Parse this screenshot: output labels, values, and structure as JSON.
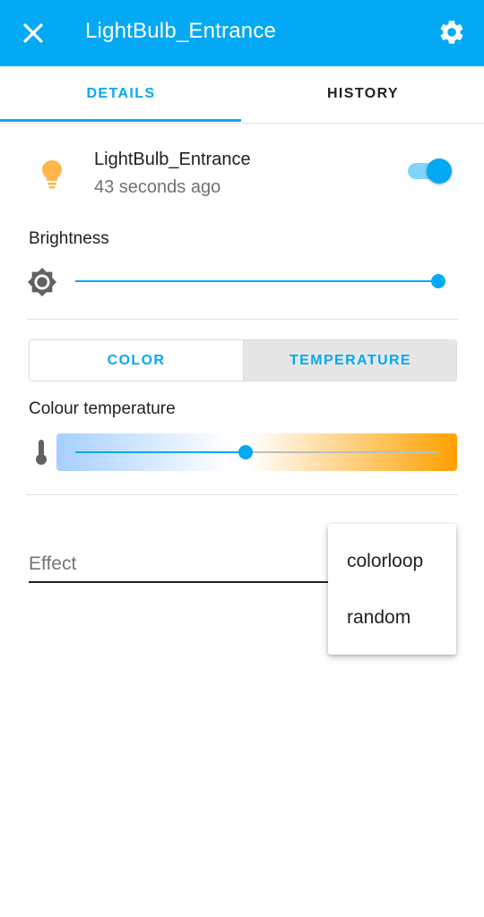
{
  "header": {
    "title": "LightBulb_Entrance",
    "close_icon": "close-icon",
    "settings_icon": "gear-icon",
    "background_color": "#03a9f4"
  },
  "tabs": [
    {
      "label": "DETAILS",
      "active": true
    },
    {
      "label": "HISTORY",
      "active": false
    }
  ],
  "entity": {
    "name": "LightBulb_Entrance",
    "last_changed": "43 seconds ago",
    "icon": "lightbulb-icon",
    "icon_color": "#ffb74d",
    "state_on": true
  },
  "brightness": {
    "label": "Brightness",
    "icon": "brightness-icon",
    "value_fraction": 1.0
  },
  "mode": {
    "options": [
      "COLOR",
      "TEMPERATURE"
    ],
    "selected": "TEMPERATURE"
  },
  "color_temperature": {
    "label": "Colour temperature",
    "icon": "thermometer-icon",
    "value_fraction": 0.47
  },
  "effect": {
    "placeholder": "Effect",
    "options": [
      "colorloop",
      "random"
    ]
  },
  "accent_color": "#03a9f4"
}
